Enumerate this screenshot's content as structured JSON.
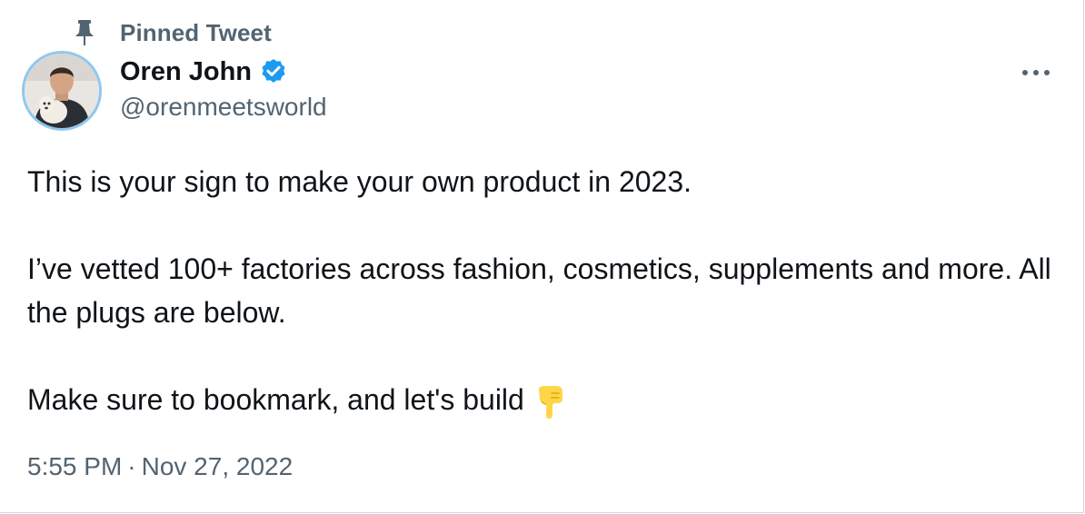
{
  "pinned": {
    "label": "Pinned Tweet",
    "icon": "pin-icon"
  },
  "author": {
    "name": "Oren John",
    "handle": "@orenmeetsworld",
    "verified": true,
    "verified_color": "#1d9bf0",
    "avatar_ring_color": "#8ec8ef"
  },
  "tweet": {
    "line1": "This is your sign to make your own product in 2023.",
    "line2": "I’ve vetted 100+ factories across fashion, cosmetics, supplements and more. All the plugs are below.",
    "line3": "Make sure to bookmark, and let's build",
    "emoji": "pointing-down-hand-icon"
  },
  "meta": {
    "time": "5:55 PM",
    "separator": "·",
    "date": "Nov 27, 2022"
  },
  "menu": {
    "icon": "more-options-icon"
  },
  "colors": {
    "text_primary": "#0f1419",
    "text_secondary": "#536471",
    "border": "#cfd9de"
  }
}
